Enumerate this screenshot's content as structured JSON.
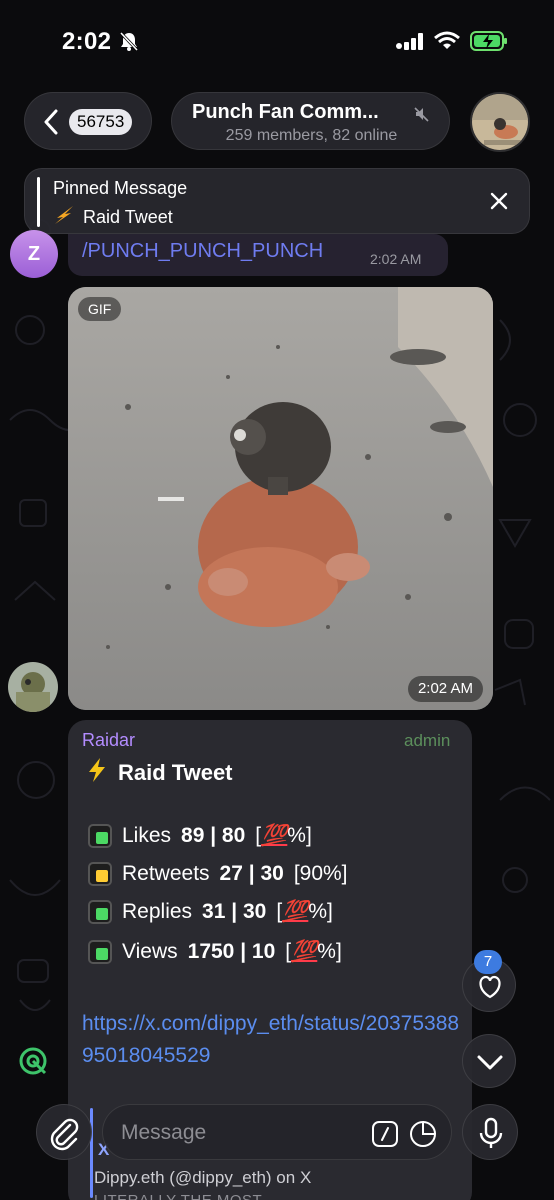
{
  "status_bar": {
    "time": "2:02"
  },
  "header": {
    "back_count": "56753",
    "title": "Punch Fan Comm...",
    "subtitle": "259 members, 82 online"
  },
  "pinned": {
    "title": "Pinned Message",
    "text": "Raid Tweet"
  },
  "messages": {
    "command": {
      "avatar_letter": "Z",
      "text": "/PUNCH_PUNCH_PUNCH",
      "time": "2:02 AM"
    },
    "gif": {
      "badge": "GIF",
      "time": "2:02 AM"
    },
    "raid": {
      "sender": "Raidar",
      "role": "admin",
      "title": "Raid Tweet",
      "stats": [
        {
          "label": "Likes",
          "value": "89 | 80",
          "pct_pre": "[",
          "pct_emoji": "💯",
          "pct_post": "%]",
          "status": "green"
        },
        {
          "label": "Retweets",
          "value": "27 | 30",
          "pct_pre": "[90%]",
          "pct_emoji": "",
          "pct_post": "",
          "status": "yellow"
        },
        {
          "label": "Replies",
          "value": "31 | 30",
          "pct_pre": "[",
          "pct_emoji": "💯",
          "pct_post": "%]",
          "status": "green"
        },
        {
          "label": "Views",
          "value": "1750 | 10",
          "pct_pre": "[",
          "pct_emoji": "💯",
          "pct_post": "%]",
          "status": "green"
        }
      ],
      "link": "https://x.com/dippy_eth/status/2037538895018045529",
      "preview_site": "X",
      "preview_title": "Dippy.eth (@dippy_eth) on X",
      "preview_desc": "LITERALLY THE MOST"
    }
  },
  "floating": {
    "reaction_count": "7"
  },
  "input": {
    "placeholder": "Message"
  }
}
